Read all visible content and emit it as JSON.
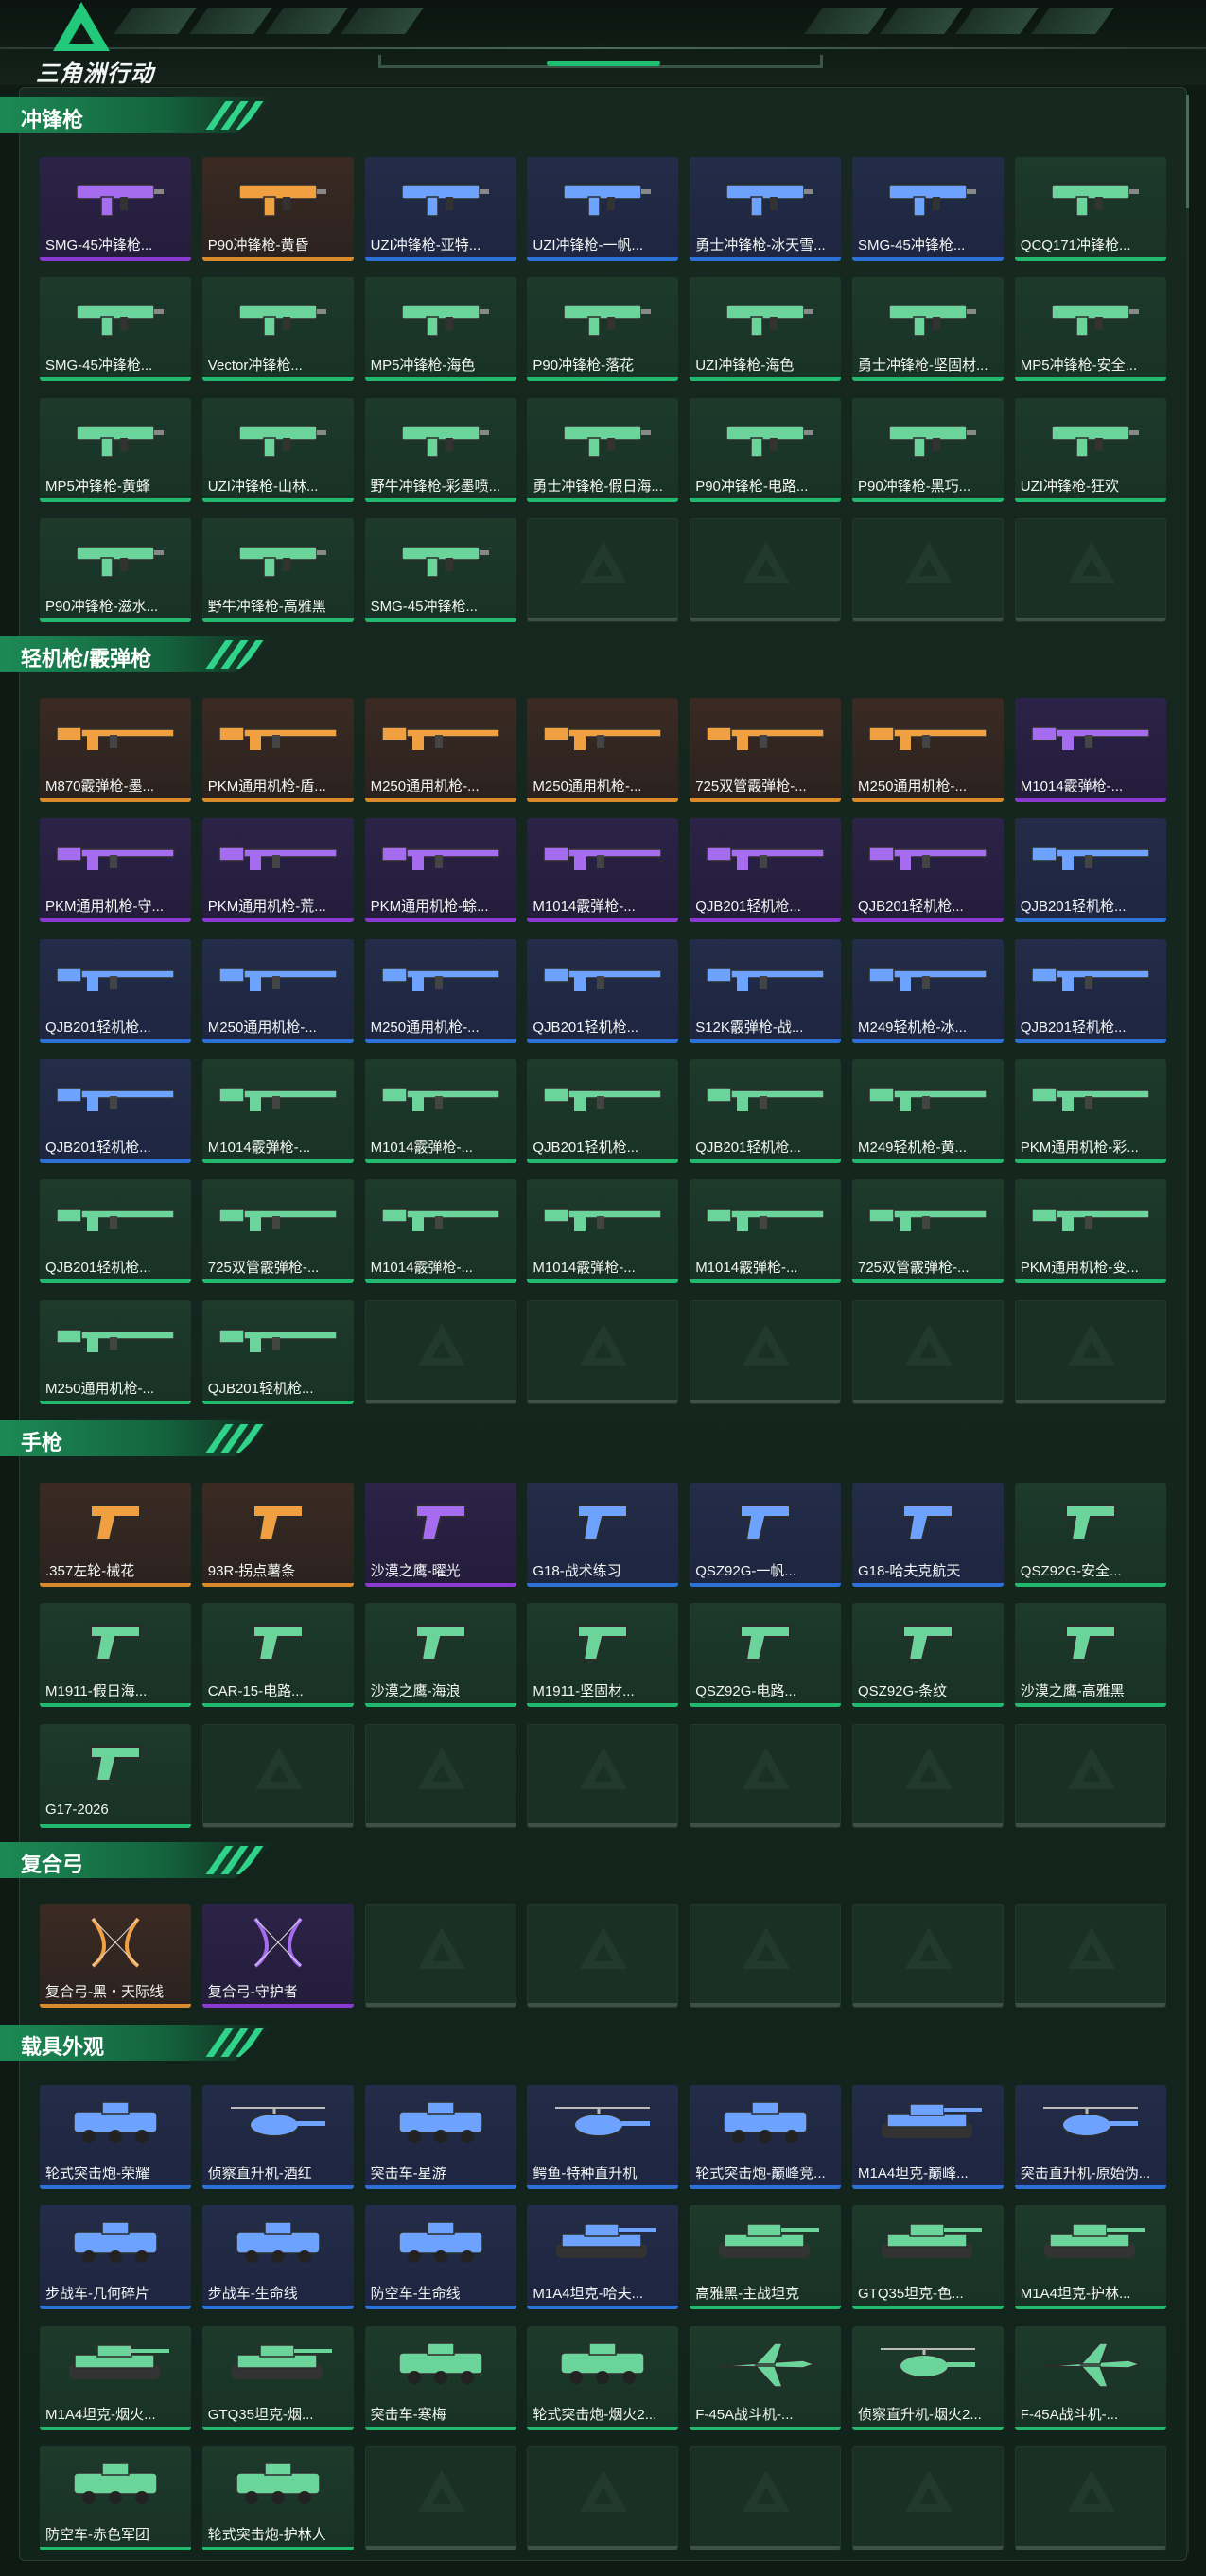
{
  "app": {
    "logo_text": "三角洲行动"
  },
  "colors": {
    "legendary": "#d98a2b",
    "epic": "#8a3ad1",
    "rare": "#2c71d6",
    "uncommon": "#22b86e",
    "empty": "#3e5148",
    "accent": "#1fbf73"
  },
  "sections": [
    {
      "title": "冲锋枪",
      "items": [
        {
          "name": "SMG-45冲锋枪...",
          "tier": "epic",
          "icon": "smg-icon"
        },
        {
          "name": "P90冲锋枪-黄昏",
          "tier": "legendary",
          "icon": "smg-icon"
        },
        {
          "name": "UZI冲锋枪-亚特...",
          "tier": "rare",
          "icon": "smg-icon"
        },
        {
          "name": "UZI冲锋枪-一帆...",
          "tier": "rare",
          "icon": "smg-icon"
        },
        {
          "name": "勇士冲锋枪-冰天雪...",
          "tier": "rare",
          "icon": "smg-icon"
        },
        {
          "name": "SMG-45冲锋枪...",
          "tier": "rare",
          "icon": "smg-icon"
        },
        {
          "name": "QCQ171冲锋枪...",
          "tier": "uncommon",
          "icon": "smg-icon"
        },
        {
          "name": "SMG-45冲锋枪...",
          "tier": "uncommon",
          "icon": "smg-icon"
        },
        {
          "name": "Vector冲锋枪...",
          "tier": "uncommon",
          "icon": "smg-icon"
        },
        {
          "name": "MP5冲锋枪-海色",
          "tier": "uncommon",
          "icon": "smg-icon"
        },
        {
          "name": "P90冲锋枪-落花",
          "tier": "uncommon",
          "icon": "smg-icon"
        },
        {
          "name": "UZI冲锋枪-海色",
          "tier": "uncommon",
          "icon": "smg-icon"
        },
        {
          "name": "勇士冲锋枪-坚固材...",
          "tier": "uncommon",
          "icon": "smg-icon"
        },
        {
          "name": "MP5冲锋枪-安全...",
          "tier": "uncommon",
          "icon": "smg-icon"
        },
        {
          "name": "MP5冲锋枪-黄蜂",
          "tier": "uncommon",
          "icon": "smg-icon"
        },
        {
          "name": "UZI冲锋枪-山林...",
          "tier": "uncommon",
          "icon": "smg-icon"
        },
        {
          "name": "野牛冲锋枪-彩墨喷...",
          "tier": "uncommon",
          "icon": "smg-icon"
        },
        {
          "name": "勇士冲锋枪-假日海...",
          "tier": "uncommon",
          "icon": "smg-icon"
        },
        {
          "name": "P90冲锋枪-电路...",
          "tier": "uncommon",
          "icon": "smg-icon"
        },
        {
          "name": "P90冲锋枪-黑巧...",
          "tier": "uncommon",
          "icon": "smg-icon"
        },
        {
          "name": "UZI冲锋枪-狂欢",
          "tier": "uncommon",
          "icon": "smg-icon"
        },
        {
          "name": "P90冲锋枪-滋水...",
          "tier": "uncommon",
          "icon": "smg-icon"
        },
        {
          "name": "野牛冲锋枪-高雅黑",
          "tier": "uncommon",
          "icon": "smg-icon"
        },
        {
          "name": "SMG-45冲锋枪...",
          "tier": "uncommon",
          "icon": "smg-icon"
        },
        {
          "empty": true
        },
        {
          "empty": true
        },
        {
          "empty": true
        },
        {
          "empty": true
        }
      ]
    },
    {
      "title": "轻机枪/霰弹枪",
      "items": [
        {
          "name": "M870霰弹枪-墨...",
          "tier": "legendary",
          "icon": "rifle-icon"
        },
        {
          "name": "PKM通用机枪-盾...",
          "tier": "legendary",
          "icon": "rifle-icon"
        },
        {
          "name": "M250通用机枪-...",
          "tier": "legendary",
          "icon": "rifle-icon"
        },
        {
          "name": "M250通用机枪-...",
          "tier": "legendary",
          "icon": "rifle-icon"
        },
        {
          "name": "725双管霰弹枪-...",
          "tier": "legendary",
          "icon": "rifle-icon"
        },
        {
          "name": "M250通用机枪-...",
          "tier": "legendary",
          "icon": "rifle-icon"
        },
        {
          "name": "M1014霰弹枪-...",
          "tier": "epic",
          "icon": "rifle-icon"
        },
        {
          "name": "PKM通用机枪-守...",
          "tier": "epic",
          "icon": "rifle-icon"
        },
        {
          "name": "PKM通用机枪-荒...",
          "tier": "epic",
          "icon": "rifle-icon"
        },
        {
          "name": "PKM通用机枪-蜍...",
          "tier": "epic",
          "icon": "rifle-icon"
        },
        {
          "name": "M1014霰弹枪-...",
          "tier": "epic",
          "icon": "rifle-icon"
        },
        {
          "name": "QJB201轻机枪...",
          "tier": "epic",
          "icon": "rifle-icon"
        },
        {
          "name": "QJB201轻机枪...",
          "tier": "epic",
          "icon": "rifle-icon"
        },
        {
          "name": "QJB201轻机枪...",
          "tier": "rare",
          "icon": "rifle-icon"
        },
        {
          "name": "QJB201轻机枪...",
          "tier": "rare",
          "icon": "rifle-icon"
        },
        {
          "name": "M250通用机枪-...",
          "tier": "rare",
          "icon": "rifle-icon"
        },
        {
          "name": "M250通用机枪-...",
          "tier": "rare",
          "icon": "rifle-icon"
        },
        {
          "name": "QJB201轻机枪...",
          "tier": "rare",
          "icon": "rifle-icon"
        },
        {
          "name": "S12K霰弹枪-战...",
          "tier": "rare",
          "icon": "rifle-icon"
        },
        {
          "name": "M249轻机枪-冰...",
          "tier": "rare",
          "icon": "rifle-icon"
        },
        {
          "name": "QJB201轻机枪...",
          "tier": "rare",
          "icon": "rifle-icon"
        },
        {
          "name": "QJB201轻机枪...",
          "tier": "rare",
          "icon": "rifle-icon"
        },
        {
          "name": "M1014霰弹枪-...",
          "tier": "uncommon",
          "icon": "rifle-icon"
        },
        {
          "name": "M1014霰弹枪-...",
          "tier": "uncommon",
          "icon": "rifle-icon"
        },
        {
          "name": "QJB201轻机枪...",
          "tier": "uncommon",
          "icon": "rifle-icon"
        },
        {
          "name": "QJB201轻机枪...",
          "tier": "uncommon",
          "icon": "rifle-icon"
        },
        {
          "name": "M249轻机枪-黄...",
          "tier": "uncommon",
          "icon": "rifle-icon"
        },
        {
          "name": "PKM通用机枪-彩...",
          "tier": "uncommon",
          "icon": "rifle-icon"
        },
        {
          "name": "QJB201轻机枪...",
          "tier": "uncommon",
          "icon": "rifle-icon"
        },
        {
          "name": "725双管霰弹枪-...",
          "tier": "uncommon",
          "icon": "rifle-icon"
        },
        {
          "name": "M1014霰弹枪-...",
          "tier": "uncommon",
          "icon": "rifle-icon"
        },
        {
          "name": "M1014霰弹枪-...",
          "tier": "uncommon",
          "icon": "rifle-icon"
        },
        {
          "name": "M1014霰弹枪-...",
          "tier": "uncommon",
          "icon": "rifle-icon"
        },
        {
          "name": "725双管霰弹枪-...",
          "tier": "uncommon",
          "icon": "rifle-icon"
        },
        {
          "name": "PKM通用机枪-变...",
          "tier": "uncommon",
          "icon": "rifle-icon"
        },
        {
          "name": "M250通用机枪-...",
          "tier": "uncommon",
          "icon": "rifle-icon"
        },
        {
          "name": "QJB201轻机枪...",
          "tier": "uncommon",
          "icon": "rifle-icon"
        },
        {
          "empty": true
        },
        {
          "empty": true
        },
        {
          "empty": true
        },
        {
          "empty": true
        },
        {
          "empty": true
        }
      ]
    },
    {
      "title": "手枪",
      "items": [
        {
          "name": ".357左轮-械花",
          "tier": "legendary",
          "icon": "pistol-icon"
        },
        {
          "name": "93R-拐点薯条",
          "tier": "legendary",
          "icon": "pistol-icon"
        },
        {
          "name": "沙漠之鹰-曜光",
          "tier": "epic",
          "icon": "pistol-icon"
        },
        {
          "name": "G18-战术练习",
          "tier": "rare",
          "icon": "pistol-icon"
        },
        {
          "name": "QSZ92G-一帆...",
          "tier": "rare",
          "icon": "pistol-icon"
        },
        {
          "name": "G18-哈夫克航天",
          "tier": "rare",
          "icon": "pistol-icon"
        },
        {
          "name": "QSZ92G-安全...",
          "tier": "uncommon",
          "icon": "pistol-icon"
        },
        {
          "name": "M1911-假日海...",
          "tier": "uncommon",
          "icon": "pistol-icon"
        },
        {
          "name": "CAR-15-电路...",
          "tier": "uncommon",
          "icon": "pistol-icon"
        },
        {
          "name": "沙漠之鹰-海浪",
          "tier": "uncommon",
          "icon": "pistol-icon"
        },
        {
          "name": "M1911-坚固材...",
          "tier": "uncommon",
          "icon": "pistol-icon"
        },
        {
          "name": "QSZ92G-电路...",
          "tier": "uncommon",
          "icon": "pistol-icon"
        },
        {
          "name": "QSZ92G-条纹",
          "tier": "uncommon",
          "icon": "pistol-icon"
        },
        {
          "name": "沙漠之鹰-高雅黑",
          "tier": "uncommon",
          "icon": "pistol-icon"
        },
        {
          "name": "G17-2026",
          "tier": "uncommon",
          "icon": "pistol-icon"
        },
        {
          "empty": true
        },
        {
          "empty": true
        },
        {
          "empty": true
        },
        {
          "empty": true
        },
        {
          "empty": true
        },
        {
          "empty": true
        }
      ]
    },
    {
      "title": "复合弓",
      "items": [
        {
          "name": "复合弓-黑・天际线",
          "tier": "legendary",
          "icon": "bow-icon"
        },
        {
          "name": "复合弓-守护者",
          "tier": "epic",
          "icon": "bow-icon"
        },
        {
          "empty": true
        },
        {
          "empty": true
        },
        {
          "empty": true
        },
        {
          "empty": true
        },
        {
          "empty": true
        }
      ]
    },
    {
      "title": "载具外观",
      "items": [
        {
          "name": "轮式突击炮-荣耀",
          "tier": "rare",
          "icon": "vehicle-icon"
        },
        {
          "name": "侦察直升机-酒红",
          "tier": "rare",
          "icon": "helicopter-icon"
        },
        {
          "name": "突击车-星游",
          "tier": "rare",
          "icon": "vehicle-icon"
        },
        {
          "name": "鳄鱼-特种直升机",
          "tier": "rare",
          "icon": "helicopter-icon"
        },
        {
          "name": "轮式突击炮-巅峰竞...",
          "tier": "rare",
          "icon": "vehicle-icon"
        },
        {
          "name": "M1A4坦克-巅峰...",
          "tier": "rare",
          "icon": "tank-icon"
        },
        {
          "name": "突击直升机-原始伪...",
          "tier": "rare",
          "icon": "helicopter-icon"
        },
        {
          "name": "步战车-几何碎片",
          "tier": "rare",
          "icon": "vehicle-icon"
        },
        {
          "name": "步战车-生命线",
          "tier": "rare",
          "icon": "vehicle-icon"
        },
        {
          "name": "防空车-生命线",
          "tier": "rare",
          "icon": "vehicle-icon"
        },
        {
          "name": "M1A4坦克-哈夫...",
          "tier": "rare",
          "icon": "tank-icon"
        },
        {
          "name": "高雅黑-主战坦克",
          "tier": "uncommon",
          "icon": "tank-icon"
        },
        {
          "name": "GTQ35坦克-色...",
          "tier": "uncommon",
          "icon": "tank-icon"
        },
        {
          "name": "M1A4坦克-护林...",
          "tier": "uncommon",
          "icon": "tank-icon"
        },
        {
          "name": "M1A4坦克-烟火...",
          "tier": "uncommon",
          "icon": "tank-icon"
        },
        {
          "name": "GTQ35坦克-烟...",
          "tier": "uncommon",
          "icon": "tank-icon"
        },
        {
          "name": "突击车-寒梅",
          "tier": "uncommon",
          "icon": "vehicle-icon"
        },
        {
          "name": "轮式突击炮-烟火2...",
          "tier": "uncommon",
          "icon": "vehicle-icon"
        },
        {
          "name": "F-45A战斗机-...",
          "tier": "uncommon",
          "icon": "jet-icon"
        },
        {
          "name": "侦察直升机-烟火2...",
          "tier": "uncommon",
          "icon": "helicopter-icon"
        },
        {
          "name": "F-45A战斗机-...",
          "tier": "uncommon",
          "icon": "jet-icon"
        },
        {
          "name": "防空车-赤色军团",
          "tier": "uncommon",
          "icon": "vehicle-icon"
        },
        {
          "name": "轮式突击炮-护林人",
          "tier": "uncommon",
          "icon": "vehicle-icon"
        },
        {
          "empty": true
        },
        {
          "empty": true
        },
        {
          "empty": true
        },
        {
          "empty": true
        },
        {
          "empty": true
        }
      ]
    }
  ]
}
